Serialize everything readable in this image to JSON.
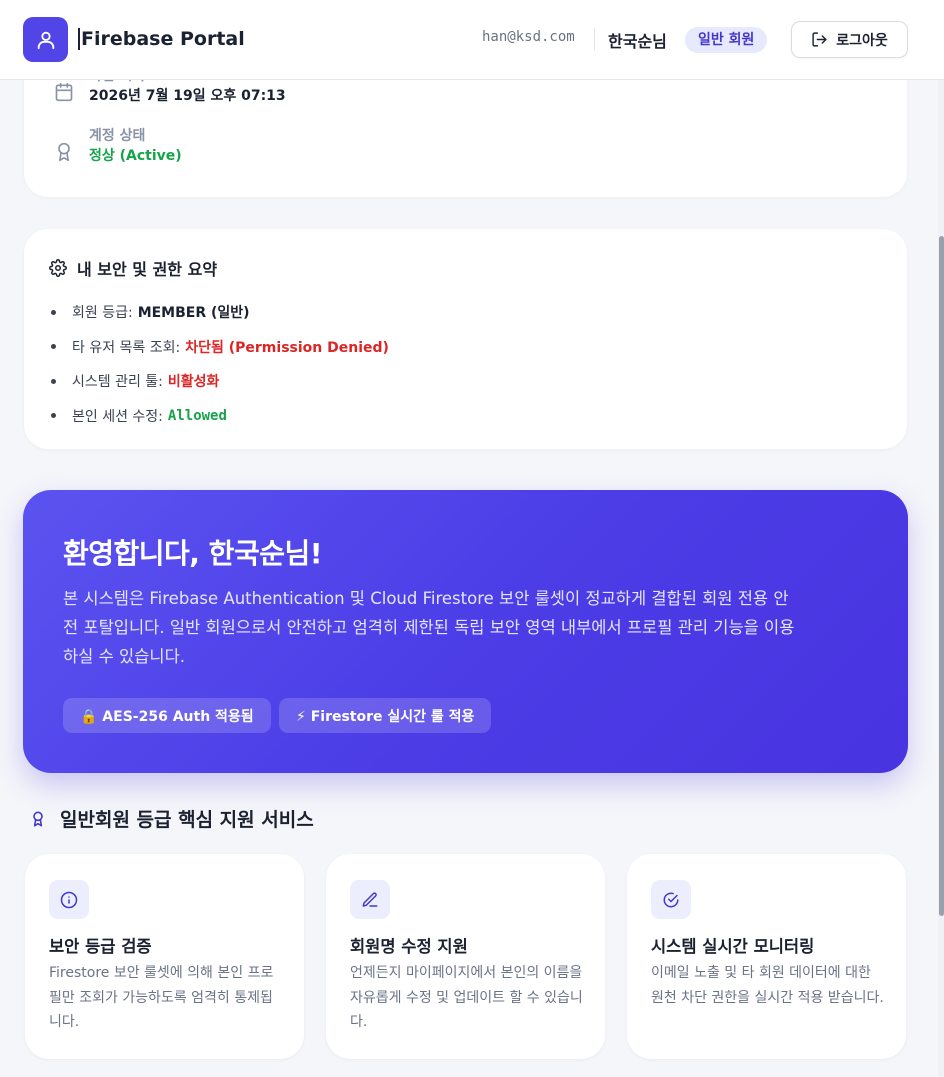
{
  "header": {
    "title": "Firebase Portal",
    "email": "han@ksd.com",
    "username": "한국순님",
    "role_badge": "일반 회원",
    "logout_label": "로그아웃"
  },
  "account_info": {
    "joined_label": "가입 시각",
    "joined_value": "2026년 7월 19일 오후 07:13",
    "status_label": "계정 상태",
    "status_value": "정상 (Active)"
  },
  "security_summary": {
    "title": "내 보안 및 권한 요약",
    "items": [
      {
        "label": "회원 등급:",
        "value": "MEMBER (일반)",
        "color": "#1b2130"
      },
      {
        "label": "타 유저 목록 조회:",
        "value": "차단됨 (Permission Denied)",
        "color": "#dc2626"
      },
      {
        "label": "시스템 관리 툴:",
        "value": "비활성화",
        "color": "#dc2626"
      },
      {
        "label": "본인 세션 수정:",
        "value": "Allowed",
        "color": "#16a34a"
      }
    ]
  },
  "hero": {
    "title": "환영합니다, 한국순님!",
    "description": "본 시스템은 Firebase Authentication 및 Cloud Firestore 보안 룰셋이 정교하게 결합된 회원 전용 안전 포탈입니다. 일반 회원으로서 안전하고 엄격히 제한된 독립 보안 영역 내부에서 프로필 관리 기능을 이용하실 수 있습니다.",
    "chips": [
      "🔒 AES-256 Auth 적용됨",
      "⚡ Firestore 실시간 룰 적용"
    ]
  },
  "services": {
    "heading": "일반회원 등급 핵심 지원 서비스",
    "cards": [
      {
        "icon": "info-icon",
        "title": "보안 등급 검증",
        "desc": "Firestore 보안 룰셋에 의해 본인 프로필만 조회가 가능하도록 엄격히 통제됩니다."
      },
      {
        "icon": "pencil-icon",
        "title": "회원명 수정 지원",
        "desc": "언제든지 마이페이지에서 본인의 이름을 자유롭게 수정 및 업데이트 할 수 있습니다."
      },
      {
        "icon": "check-circle-icon",
        "title": "시스템 실시간 모니터링",
        "desc": "이메일 노출 및 타 회원 데이터에 대한 원천 차단 권한을 실시간 적용 받습니다."
      }
    ]
  },
  "colors": {
    "accent": "#5145e8",
    "success": "#16a34a",
    "danger": "#dc2626"
  }
}
